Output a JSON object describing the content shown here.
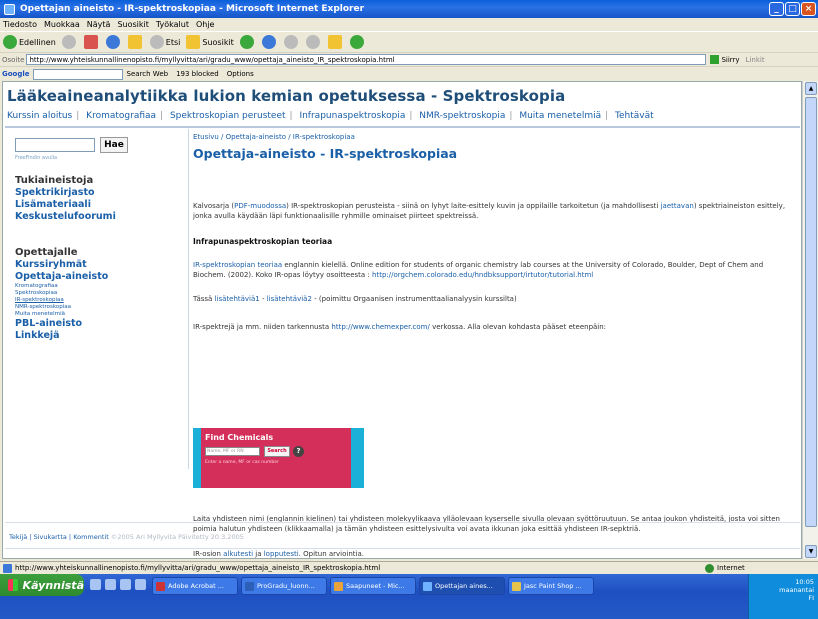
{
  "window": {
    "title": "Opettajan aineisto - IR-spektroskopiaa - Microsoft Internet Explorer"
  },
  "menu": [
    "Tiedosto",
    "Muokkaa",
    "Näytä",
    "Suosikit",
    "Työkalut",
    "Ohje"
  ],
  "toolbar": {
    "back": "Edellinen",
    "search": "Etsi",
    "favorites": "Suosikit"
  },
  "address": {
    "label": "Osoite",
    "url": "http://www.yhteiskunnallinenopisto.fi/myllyvitta/ari/gradu_www/opettaja_aineisto_IR_spektroskopia.html",
    "go": "Siirry",
    "links": "Linkit"
  },
  "googlebar": {
    "logo": "Google",
    "search_web": "Search Web",
    "blocked": "193 blocked",
    "options": "Options"
  },
  "site": {
    "title": "Lääkeaineanalytiikka lukion kemian opetuksessa - Spektroskopia",
    "nav": [
      "Kurssin aloitus",
      "Kromatografiaa",
      "Spektroskopian perusteet",
      "Infrapunaspektroskopia",
      "NMR-spektroskopia",
      "Muita menetelmiä",
      "Tehtävät"
    ]
  },
  "sidebar": {
    "search_button": "Hae",
    "search_hint": "FreeFindin avulla",
    "heading1": "Tukiaineistoja",
    "links1": [
      "Spektrikirjasto",
      "Lisämateriaali",
      "Keskustelufoorumi"
    ],
    "heading2": "Opettajalle",
    "links2": [
      "Kurssiryhmät",
      "Opettaja-aineisto"
    ],
    "small_links": [
      "Kromatografiaa",
      "Spektroskopiaa",
      "IR-spektroskopiaa",
      "NMR-spektroskopiaa",
      "Muita menetelmiä"
    ],
    "links3": [
      "PBL-aineisto",
      "Linkkejä"
    ]
  },
  "content": {
    "breadcrumb": "Etusivu / Opettaja-aineisto / IR-spektroskopiaa",
    "heading": "Opettaja-aineisto - IR-spektroskopiaa",
    "p1_pre": "Kalvosarja (",
    "p1_link": "PDF-muodossa",
    "p1_mid": ") IR-spektroskopian perusteista - siinä on lyhyt laite-esittely kuvin ja oppilaille tarkoitetun (ja mahdollisesti ",
    "p1_link2": "jaettavan",
    "p1_post": ") spektriaineiston esittely, jonka avulla käydään läpi funktionaalisille ryhmille ominaiset piirteet spektreissä.",
    "subheading": "Infrapunaspektroskopian teoriaa",
    "p2_link": "IR-spektroskopian teoriaa",
    "p2_text": " englannin kielellä. Online edition for students of organic chemistry lab courses at the University of Colorado, Boulder, Dept of Chem and Biochem. (2002). Koko IR-opas löytyy osoitteesta : ",
    "p2_link2": "http://orgchem.colorado.edu/hndbksupport/irtutor/tutorial.html",
    "p3_pre": "Tässä ",
    "p3_link1": "lisätehtäviä1",
    "p3_sep": " - ",
    "p3_link2": "lisätehtäviä2",
    "p3_post": " - (poimittu Orgaanisen instrumenttaalianalyysin kurssilta)",
    "p4_pre": "IR-spektrejä ja mm. niiden tarkennusta ",
    "p4_link": "http://www.chemexper.com/",
    "p4_post": " verkossa. Alla olevan kohdasta pääset eteenpäin:",
    "chem": {
      "title": "Find Chemicals",
      "placeholder": "Name, MF or RN",
      "button": "Search",
      "help": "?",
      "hint": "Enter a name, MF or cas number"
    },
    "p5": "Laita yhdisteen nimi (englannin kielinen) tai yhdisteen molekyylikaava ylläolevaan kyserselle sivulla olevaan syöttöruutuun. Se antaa joukon yhdisteitä, josta voi sitten poimia halutun yhdisteen (klikkaamalla) ja tämän yhdisteen esittelysivulta voi avata ikkunan joka esittää yhdisteen IR-sepktriä.",
    "p6_pre": "IR-osion ",
    "p6_link1": "alkutesti",
    "p6_mid": " ja ",
    "p6_link2": "lopputesti",
    "p6_post": ". Opitun arviointia."
  },
  "footer": {
    "links": [
      "Tekijä",
      "Sivukartta",
      "Kommentit"
    ],
    "copyright": "©2005 Ari Myllyvita Päivitetty 20.3.2005"
  },
  "status": {
    "url": "http://www.yhteiskunnallinenopisto.fi/myllyvitta/ari/gradu_www/opettaja_aineisto_IR_spektroskopia.html",
    "zone": "Internet"
  },
  "taskbar": {
    "start": "Käynnistä",
    "items": [
      "Adobe Acrobat ...",
      "ProGradu_luonn...",
      "Saapuneet - Mic...",
      "Opettajan aines...",
      "Jasc Paint Shop ..."
    ],
    "time": "10:05",
    "day": "maanantai",
    "lang": "FI"
  }
}
